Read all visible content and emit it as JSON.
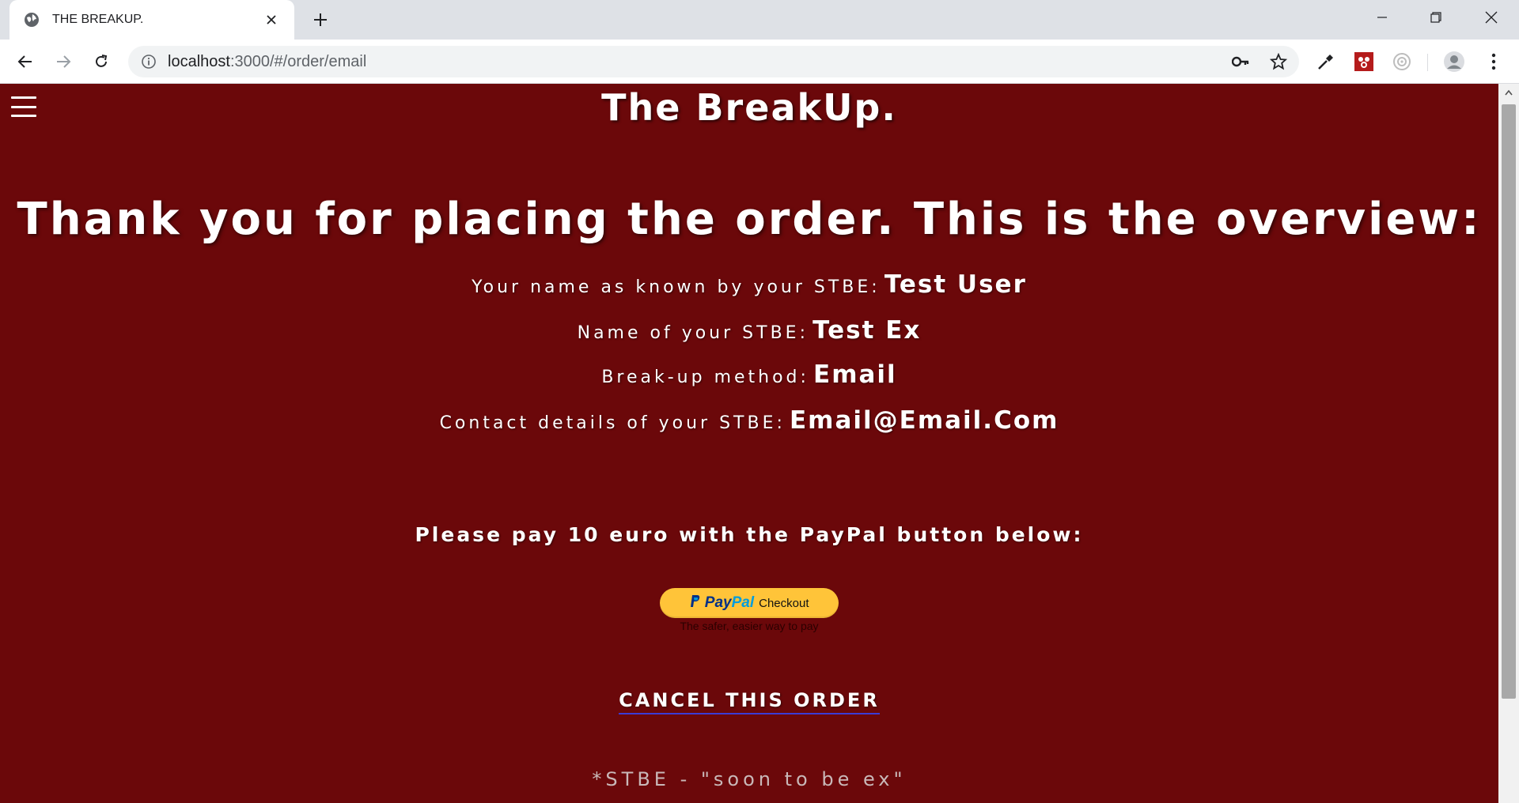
{
  "browser": {
    "tab_title": "THE BREAKUP.",
    "url_host": "localhost",
    "url_path": ":3000/#/order/email",
    "icons": {
      "favicon": "globe-icon",
      "tab_close": "close-icon",
      "new_tab": "plus-icon",
      "minimize": "minimize-icon",
      "restore": "restore-icon",
      "close": "close-icon",
      "back": "back-arrow-icon",
      "forward": "forward-arrow-icon",
      "reload": "reload-icon",
      "site_info": "info-icon",
      "password_key": "key-icon",
      "bookmark": "star-icon",
      "eyedropper": "eyedropper-icon",
      "extension": "extension-icon",
      "profile": "avatar-icon",
      "menu": "kebab-menu-icon"
    }
  },
  "page": {
    "brand": "The BreakUp.",
    "headline": "Thank you for placing the order. This is the overview:",
    "details": [
      {
        "label": "Your name as known by your STBE:",
        "value": "Test User"
      },
      {
        "label": "Name of your STBE:",
        "value": "Test Ex"
      },
      {
        "label": "Break-up method:",
        "value": "Email"
      },
      {
        "label": "Contact details of your STBE:",
        "value": "Email@Email.Com"
      }
    ],
    "pay_instruction": "Please pay 10 euro with the PayPal button below:",
    "paypal": {
      "logo_pay": "Pay",
      "logo_pal": "Pal",
      "button_text": "Checkout",
      "tagline": "The safer, easier way to pay"
    },
    "cancel_link": "CANCEL THIS ORDER",
    "footnote": "*STBE - \"soon to be ex\""
  },
  "colors": {
    "page_background": "#6b080a",
    "paypal_yellow": "#ffc439",
    "paypal_dark_blue": "#003087",
    "paypal_light_blue": "#009cde"
  }
}
